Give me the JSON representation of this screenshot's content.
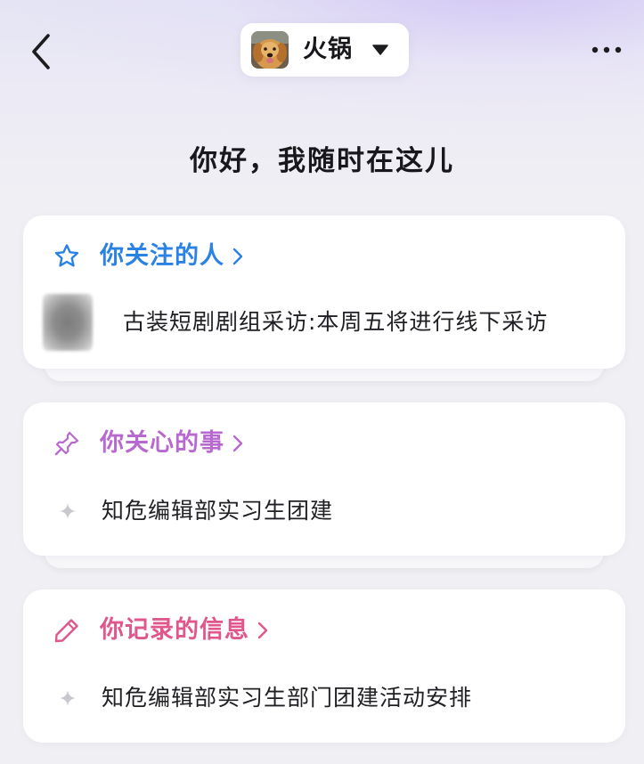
{
  "header": {
    "back_icon": "chevron-left-icon",
    "model_name": "火锅",
    "avatar": "golden-retriever-avatar",
    "dropdown_icon": "caret-down-icon",
    "more_icon": "more-horizontal-icon"
  },
  "greeting": "你好，我随时在这儿",
  "cards": [
    {
      "title": "你关注的人",
      "icon": "star-icon",
      "color": "#2a82e4",
      "items": [
        {
          "thumb": "blurred-thumbnail",
          "text": "古装短剧剧组采访:本周五将进行线下采访"
        }
      ]
    },
    {
      "title": "你关心的事",
      "icon": "pin-icon",
      "color": "#b869cf",
      "items": [
        {
          "icon": "sparkle-icon",
          "text": "知危编辑部实习生团建"
        }
      ]
    },
    {
      "title": "你记录的信息",
      "icon": "pencil-icon",
      "color": "#e0578c",
      "items": [
        {
          "icon": "sparkle-icon",
          "text": "知危编辑部实习生部门团建活动安排"
        }
      ]
    }
  ]
}
